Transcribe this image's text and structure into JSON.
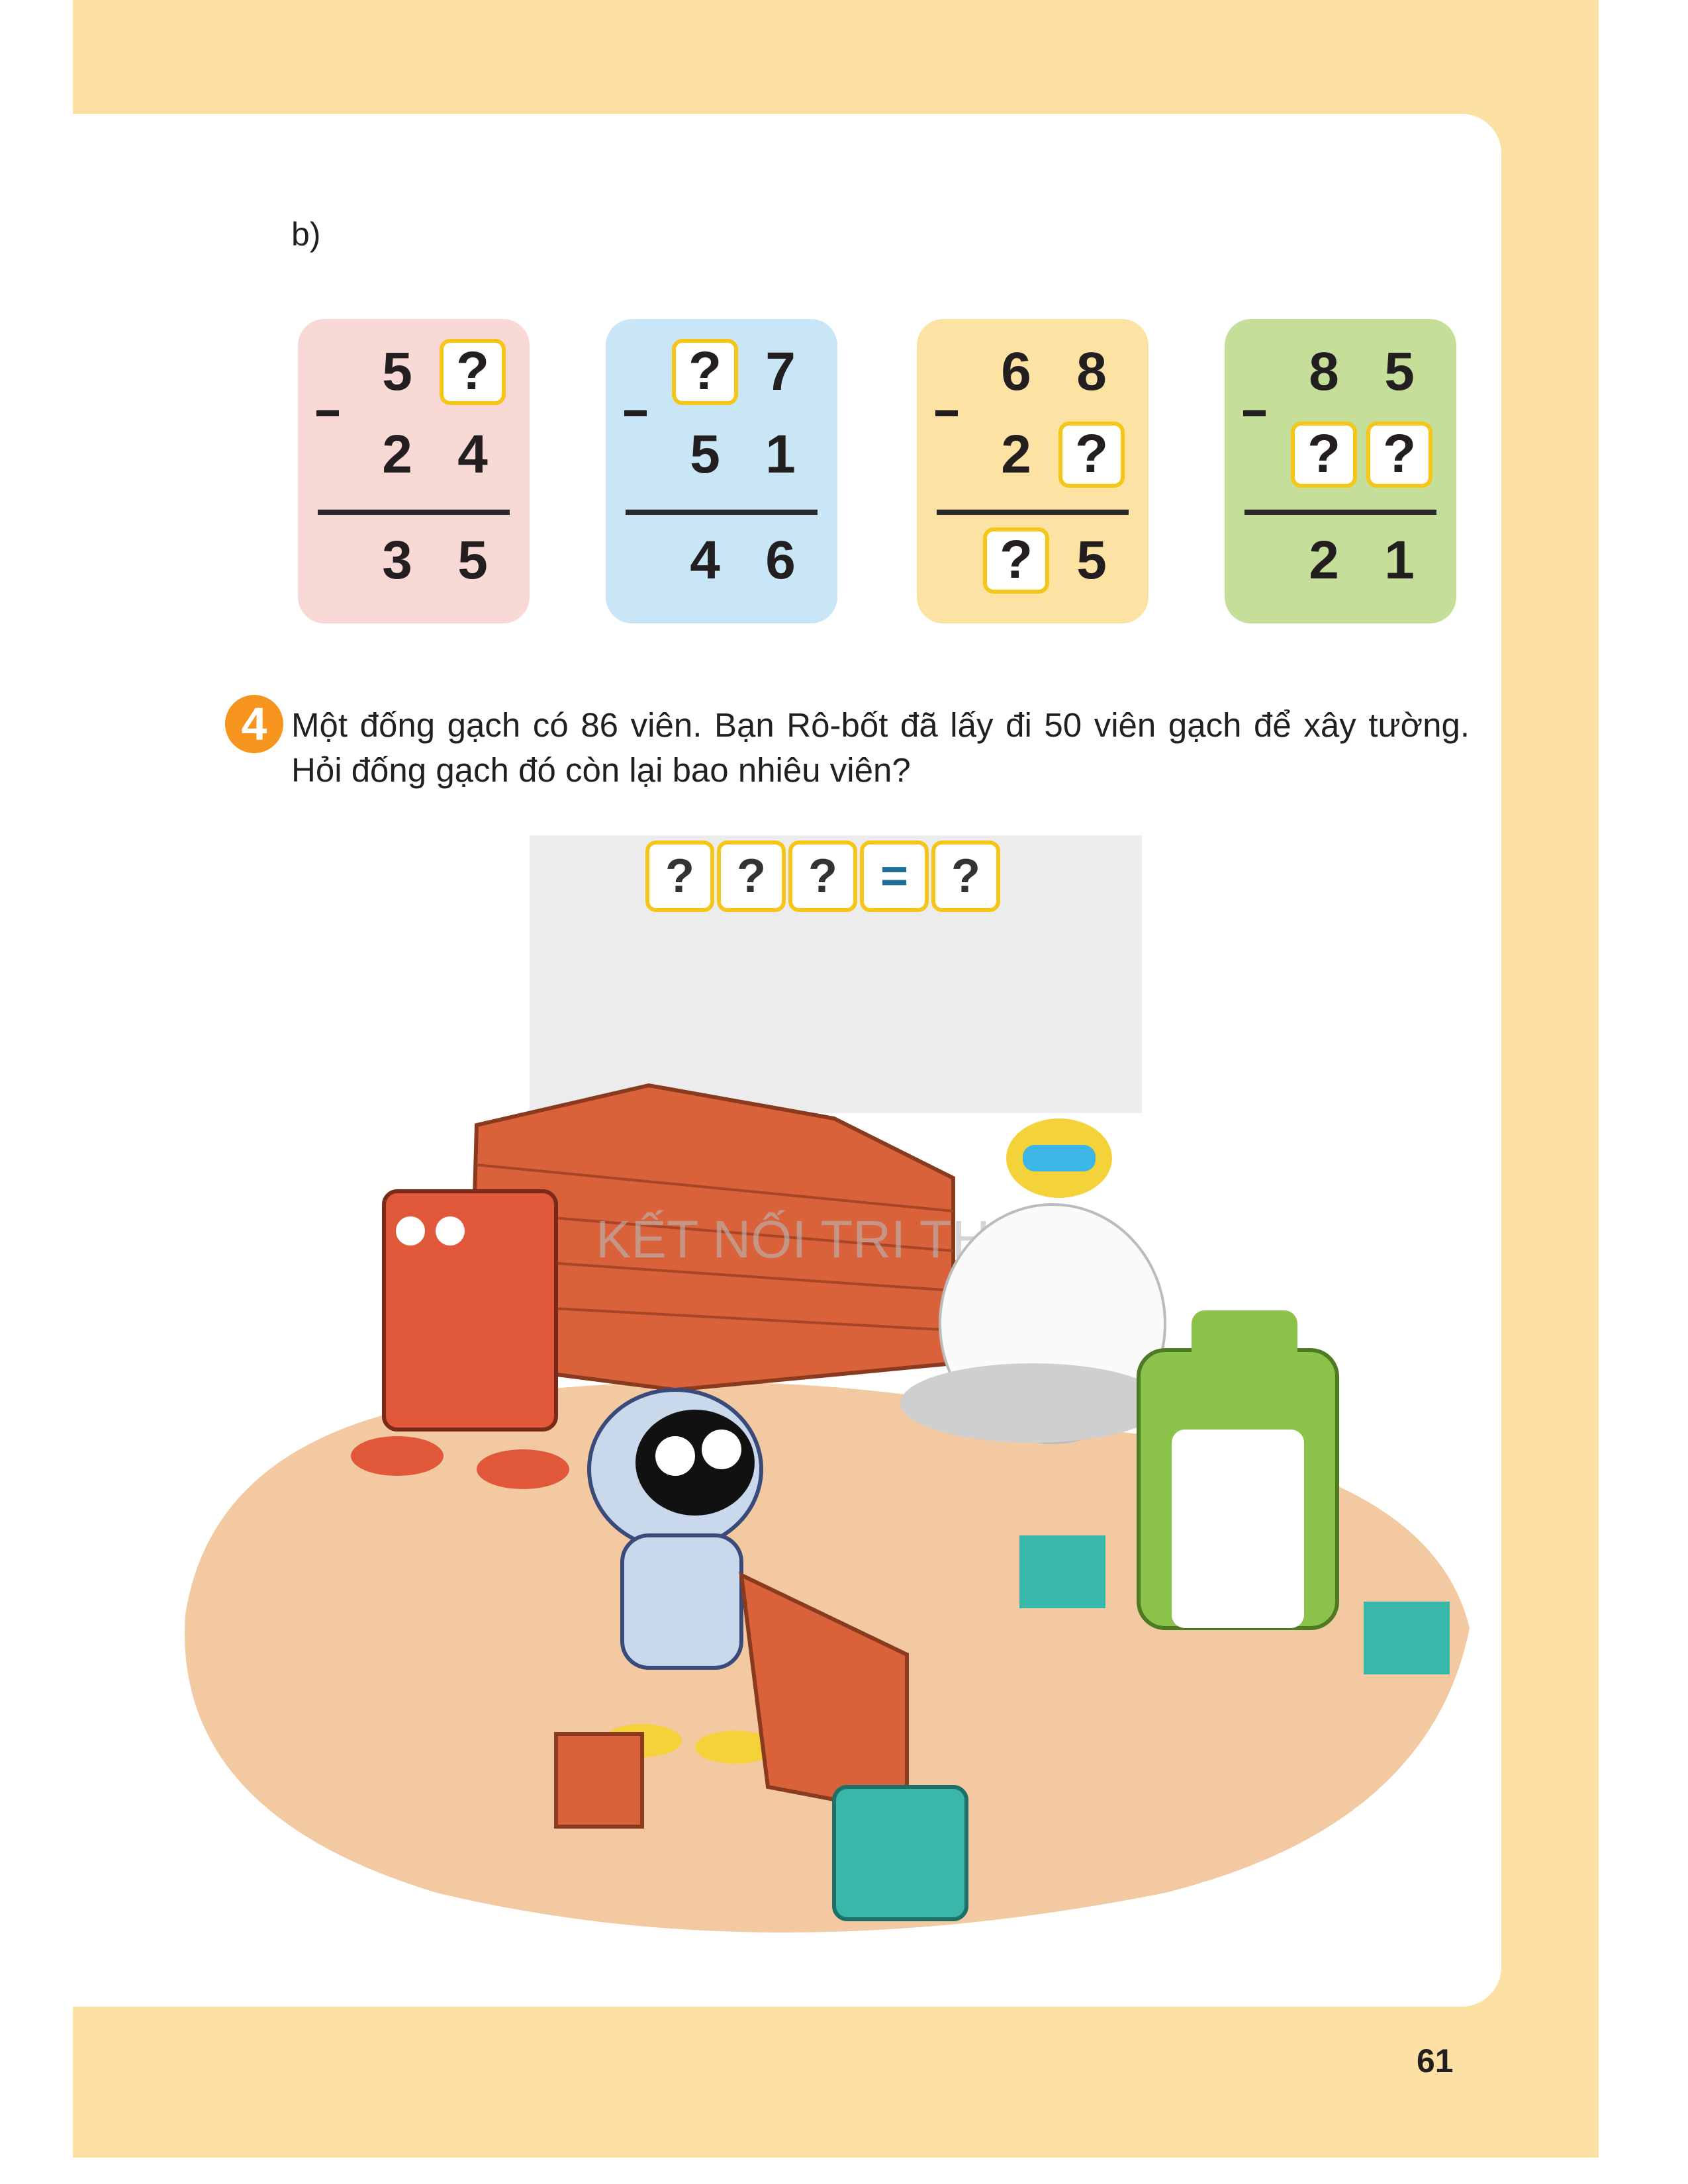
{
  "part_label": "b)",
  "problems": [
    {
      "color": "#f9d9d6",
      "top": [
        "5",
        "?"
      ],
      "bottom": [
        "2",
        "4"
      ],
      "result": [
        "3",
        "5"
      ]
    },
    {
      "color": "#c8e6f5",
      "top": [
        "?",
        "7"
      ],
      "bottom": [
        "5",
        "1"
      ],
      "result": [
        "4",
        "6"
      ]
    },
    {
      "color": "#fde3a3",
      "top": [
        "6",
        "8"
      ],
      "bottom": [
        "2",
        "?"
      ],
      "result": [
        "?",
        "5"
      ]
    },
    {
      "color": "#c5df9b",
      "top": [
        "8",
        "5"
      ],
      "bottom": [
        "?",
        "?"
      ],
      "result": [
        "2",
        "1"
      ]
    }
  ],
  "exercise4": {
    "number": "4",
    "text": "Một đống gạch có 86 viên. Bạn Rô-bốt đã lấy đi 50 viên gạch để xây tường. Hỏi đống gạch đó còn lại bao nhiêu viên?",
    "equation": [
      "?",
      "?",
      "?",
      "=",
      "?"
    ]
  },
  "watermark": "KẾT NỐI TRI THỨC VỚI CUỘC SỐNG",
  "page_number": "61"
}
